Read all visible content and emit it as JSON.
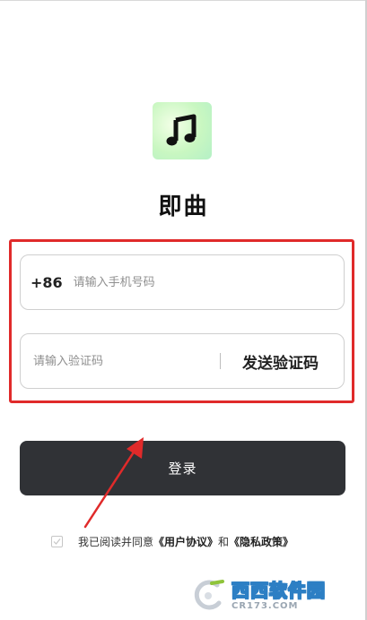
{
  "app": {
    "name": "即曲",
    "logo_icon": "music-note-icon"
  },
  "login_form": {
    "country_code": "+86",
    "phone_placeholder": "请输入手机号码",
    "code_placeholder": "请输入验证码",
    "send_code_label": "发送验证码",
    "login_label": "登录"
  },
  "agreement": {
    "prefix": "我已阅读并同意",
    "user_agreement": "《用户协议》",
    "conjunction": "和",
    "privacy_policy": "《隐私政策》",
    "checked": false
  },
  "annotation": {
    "highlight_color": "#e02a2a"
  },
  "watermark": {
    "main": "西西软件园",
    "url": "CR173.COM"
  },
  "colors": {
    "login_button": "#303236",
    "logo_background": "#c9f7c1"
  }
}
